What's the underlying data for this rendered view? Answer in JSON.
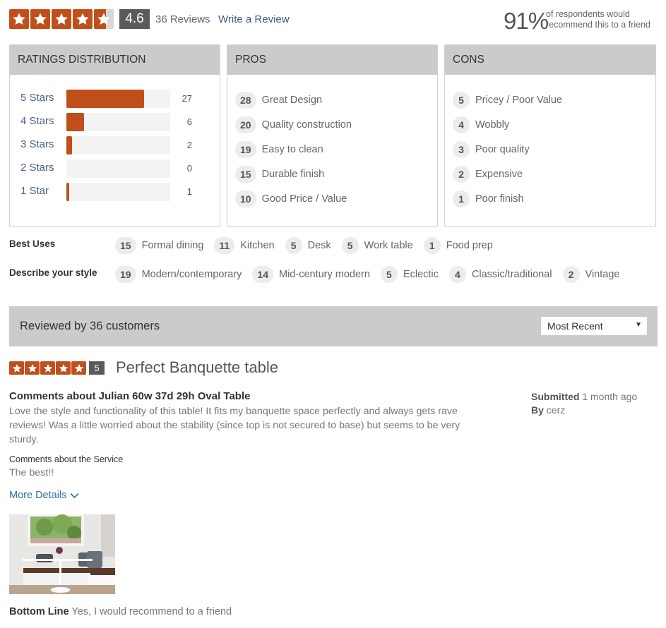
{
  "summary": {
    "average_rating": 4.6,
    "average_label": "4.6",
    "max_stars": 5,
    "review_count_label": "36 Reviews",
    "write_review_label": "Write a Review",
    "recommend_percent": "91%",
    "recommend_text_line1": "of respondents would",
    "recommend_text_line2": "recommend this to a friend"
  },
  "colors": {
    "accent": "#c14f1b",
    "badge": "#5a5a5a",
    "panel_header": "#cbcbcb",
    "link": "#3d5a80"
  },
  "ratings_distribution": {
    "title": "RATINGS DISTRIBUTION",
    "total": 36,
    "rows": [
      {
        "label": "5 Stars",
        "count": 27,
        "count_label": "27"
      },
      {
        "label": "4 Stars",
        "count": 6,
        "count_label": "6"
      },
      {
        "label": "3 Stars",
        "count": 2,
        "count_label": "2"
      },
      {
        "label": "2 Stars",
        "count": 0,
        "count_label": "0"
      },
      {
        "label": "1 Star",
        "count": 1,
        "count_label": "1"
      }
    ]
  },
  "pros": {
    "title": "PROS",
    "items": [
      {
        "count": "28",
        "label": "Great Design"
      },
      {
        "count": "20",
        "label": "Quality construction"
      },
      {
        "count": "19",
        "label": "Easy to clean"
      },
      {
        "count": "15",
        "label": "Durable finish"
      },
      {
        "count": "10",
        "label": "Good Price / Value"
      }
    ]
  },
  "cons": {
    "title": "CONS",
    "items": [
      {
        "count": "5",
        "label": "Pricey / Poor Value"
      },
      {
        "count": "4",
        "label": "Wobbly"
      },
      {
        "count": "3",
        "label": "Poor quality"
      },
      {
        "count": "2",
        "label": "Expensive"
      },
      {
        "count": "1",
        "label": "Poor finish"
      }
    ]
  },
  "best_uses": {
    "label": "Best Uses",
    "items": [
      {
        "count": "15",
        "label": "Formal dining"
      },
      {
        "count": "11",
        "label": "Kitchen"
      },
      {
        "count": "5",
        "label": "Desk"
      },
      {
        "count": "5",
        "label": "Work table"
      },
      {
        "count": "1",
        "label": "Food prep"
      }
    ]
  },
  "style": {
    "label": "Describe your style",
    "items": [
      {
        "count": "19",
        "label": "Modern/contemporary"
      },
      {
        "count": "14",
        "label": "Mid-century modern"
      },
      {
        "count": "5",
        "label": "Eclectic"
      },
      {
        "count": "4",
        "label": "Classic/traditional"
      },
      {
        "count": "2",
        "label": "Vintage"
      }
    ]
  },
  "reviews_header": {
    "title": "Reviewed by 36 customers",
    "sort_selected": "Most Recent"
  },
  "review": {
    "rating": 5,
    "rating_label": "5",
    "title": "Perfect Banquette table",
    "product_heading": "Comments about Julian 60w 37d 29h Oval Table",
    "body": "Love the style and functionality of this table! It fits my banquette space perfectly and always gets rave reviews! Was a little worried about the stability (since top is not secured to base) but seems to be very sturdy.",
    "service_label": "Comments about the Service",
    "service_text": "The best!!",
    "more_details_label": "More Details",
    "submitted_label": "Submitted",
    "submitted_value": "1 month ago",
    "by_label": "By",
    "by_value": "cerz",
    "bottom_line_label": "Bottom Line",
    "bottom_line_value": "Yes, I would recommend to a friend"
  }
}
